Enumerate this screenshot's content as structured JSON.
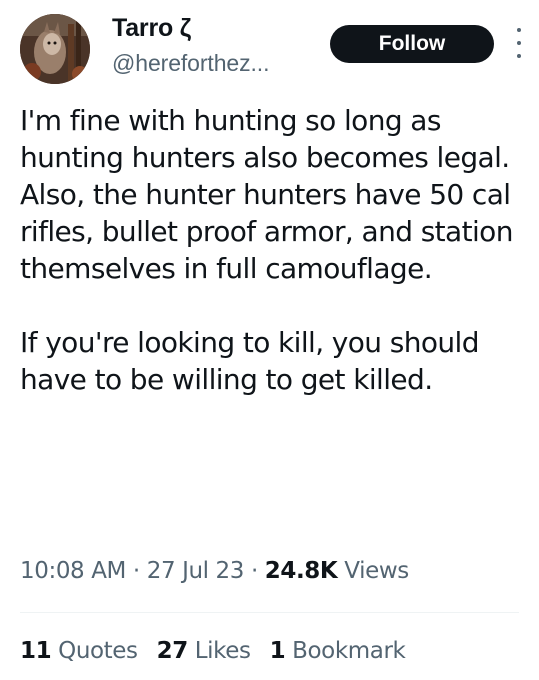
{
  "author": {
    "display_name": "Tarro ζ",
    "handle": "@hereforthez...",
    "avatar_icon": "avatar-photo"
  },
  "follow_button": {
    "label": "Follow"
  },
  "more_menu": {
    "icon": "more-vertical-icon"
  },
  "tweet": {
    "paragraphs": [
      "I'm fine with hunting so long as hunting hunters also becomes legal. Also, the hunter hunters have 50 cal rifles, bullet proof armor, and station themselves in full camouflage.",
      "If you're looking to kill, you should have to be willing to get killed."
    ]
  },
  "meta": {
    "time": "10:08 AM",
    "separator": " · ",
    "date": "27 Jul 23",
    "views_count": "24.8K",
    "views_label": " Views"
  },
  "stats": [
    {
      "count": "11",
      "label": " Quotes"
    },
    {
      "count": "27",
      "label": " Likes"
    },
    {
      "count": "1",
      "label": " Bookmark"
    }
  ],
  "colors": {
    "text": "#0f1419",
    "secondary": "#536471",
    "button_bg": "#0f1419",
    "divider": "#eff3f4"
  }
}
